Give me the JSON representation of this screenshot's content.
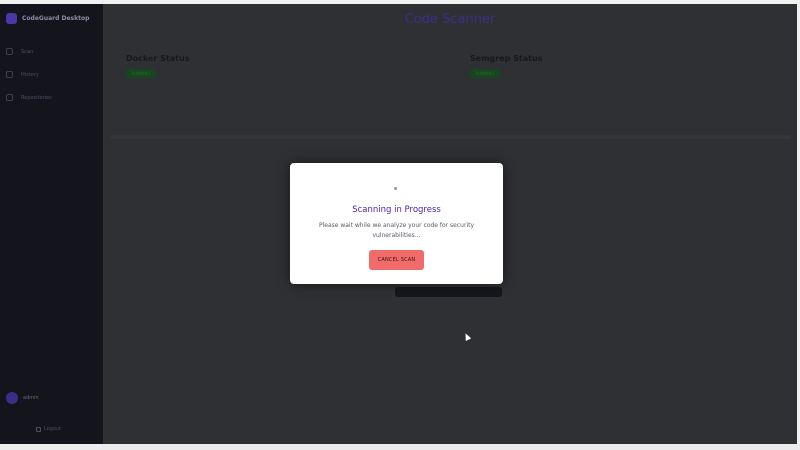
{
  "window": {
    "title": ""
  },
  "sidebar": {
    "brand": "CodeGuard Desktop",
    "items": [
      {
        "label": "Scan",
        "icon": "scan-icon"
      },
      {
        "label": "History",
        "icon": "history-icon"
      },
      {
        "label": "Repositories",
        "icon": "repo-icon"
      }
    ],
    "user": {
      "name": "admin",
      "subtitle": ""
    },
    "logout_label": "Logout"
  },
  "main": {
    "title": "Code Scanner",
    "cards": [
      {
        "title": "Docker Status",
        "badge": "RUNNING",
        "message": "",
        "link": ""
      },
      {
        "title": "Semgrep Status",
        "badge": "RUNNING",
        "message": "",
        "link": ""
      }
    ],
    "scan_note": ""
  },
  "modal": {
    "title": "Scanning in Progress",
    "text": "Please wait while we analyze your code for security vulnerabilities...",
    "cancel_label": "CANCEL SCAN"
  },
  "colors": {
    "accent": "#4a21b5",
    "cancel": "#f16b6b",
    "status_ok": "#17451f"
  }
}
